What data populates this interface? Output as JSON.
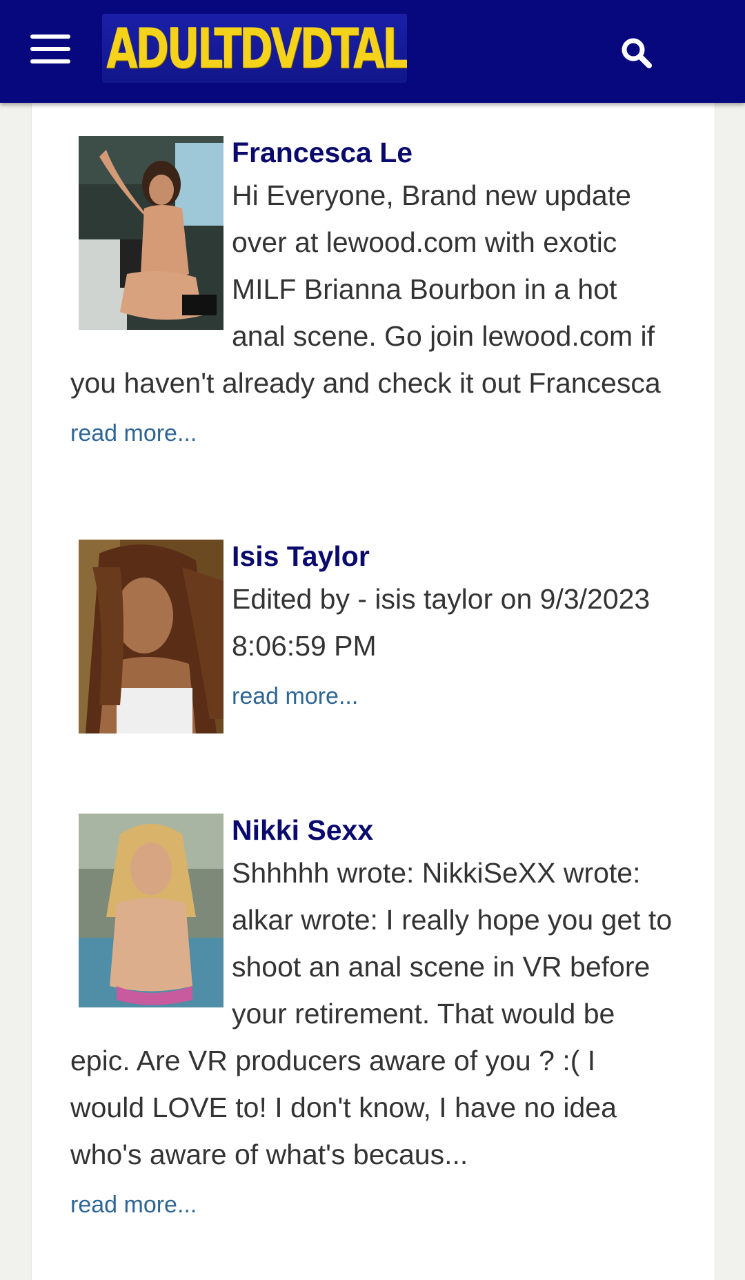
{
  "header": {
    "menu_icon": "hamburger-menu-icon",
    "logo_text": "ADULTDVDTALK",
    "search_icon": "search-icon",
    "colors": {
      "bar": "#08087e",
      "logo_text": "#f5d31a"
    }
  },
  "posts": [
    {
      "author": "Francesca Le",
      "body": "Hi Everyone, Brand new update over at lewood.com with exotic MILF Brianna Bourbon in a hot anal scene. Go join lewood.com if you haven't already and check it out Francesca",
      "read_more": "read more..."
    },
    {
      "author": "Isis Taylor",
      "body": "Edited by - isis taylor on 9/3/2023 8:06:59 PM",
      "read_more": "read more..."
    },
    {
      "author": "Nikki Sexx",
      "body": "Shhhhh wrote: NikkiSeXX wrote: alkar wrote: I really hope you get to shoot an anal scene in VR before your retirement. That would be epic. Are VR producers aware of you ? :( I would LOVE to! I don't know, I have no idea who's aware of what's becaus...",
      "read_more": "read more..."
    }
  ],
  "colors": {
    "title": "#0a0a6e",
    "body_text": "#333333",
    "link": "#2e6594",
    "page_background": "#f1f1ee"
  }
}
